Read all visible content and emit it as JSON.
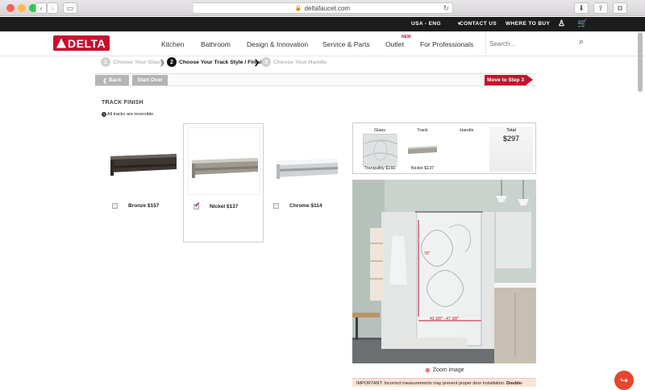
{
  "browser": {
    "url": "deltafaucet.com",
    "colors": {
      "close": "#fc605c",
      "minimize": "#fdbc40",
      "maximize": "#34c84a"
    }
  },
  "topbar": {
    "region": "USA - ENG",
    "contact": "CONTACT US",
    "where_to_buy": "WHERE TO BUY"
  },
  "nav": {
    "logo": "DELTA",
    "items": [
      "Kitchen",
      "Bathroom",
      "Design & Innovation",
      "Service & Parts",
      "Outlet",
      "For Professionals"
    ],
    "new_badge": "NEW",
    "search_placeholder": "Search..."
  },
  "steps": [
    {
      "num": "1",
      "label": "Choose Your Glass",
      "state": "inactive"
    },
    {
      "num": "2",
      "label": "Choose Your Track Style / Finish",
      "state": "active"
    },
    {
      "num": "3",
      "label": "Choose Your Handle",
      "state": "inactive"
    }
  ],
  "actions": {
    "back": "Back",
    "start_over": "Start Over",
    "next": "Move to Step 3"
  },
  "section": {
    "title": "TRACK FINISH",
    "note": "All tracks are reversible"
  },
  "options": [
    {
      "label": "Bronze $157",
      "checked": false,
      "color": "#4a4440"
    },
    {
      "label": "Nickel $137",
      "checked": true,
      "color": "#a8a49a"
    },
    {
      "label": "Chrome $114",
      "checked": false,
      "color": "#d8dadc"
    }
  ],
  "summary": {
    "glass_header": "Glass",
    "track_header": "Track",
    "handle_header": "Handle",
    "total_header": "Total",
    "total_value": "$297",
    "glass_caption": "Tranquility $160",
    "track_caption": "Nickel $137"
  },
  "preview": {
    "height_label": "70\"",
    "width_label": "43 3/8\" - 47 3/8\"",
    "zoom_label": "Zoom image"
  },
  "warning": {
    "text": "IMPORTANT: Incorrect measurements may prevent proper door installation.",
    "emphasis": "Double-"
  },
  "accent": "#c8102e"
}
